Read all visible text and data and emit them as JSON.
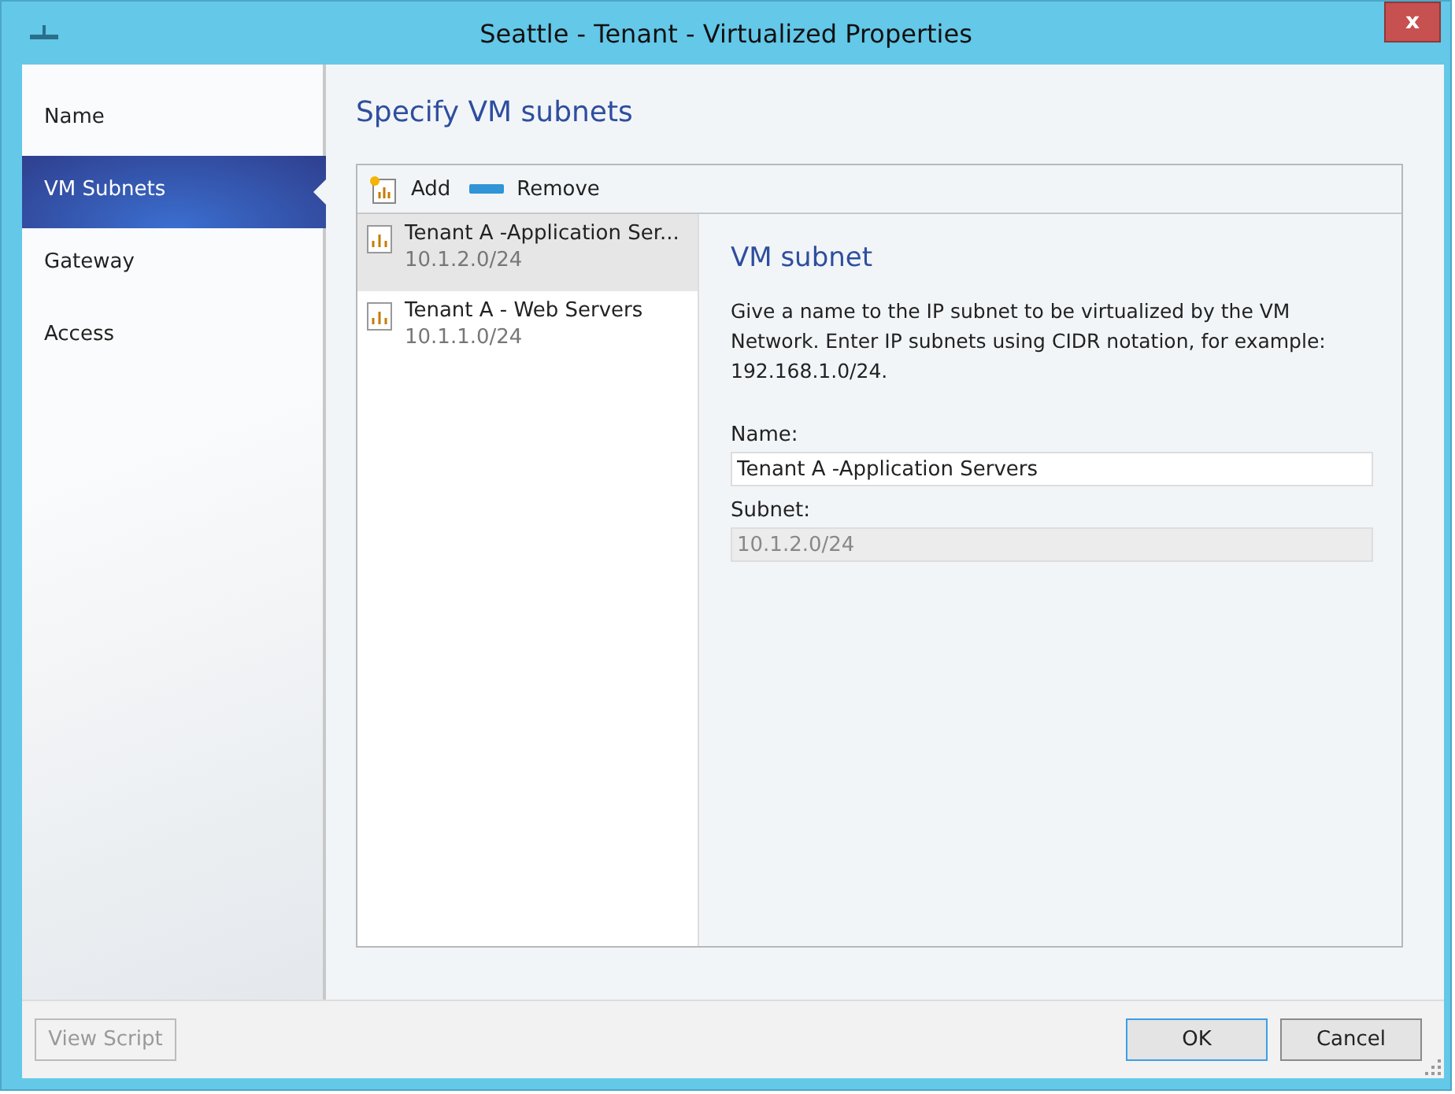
{
  "window": {
    "title": "Seattle - Tenant - Virtualized Properties",
    "close": "x"
  },
  "sidebar": {
    "items": [
      {
        "label": "Name",
        "selected": false
      },
      {
        "label": "VM Subnets",
        "selected": true
      },
      {
        "label": "Gateway",
        "selected": false
      },
      {
        "label": "Access",
        "selected": false
      }
    ]
  },
  "page_title": "Specify VM subnets",
  "toolbar": [
    {
      "kind": "add",
      "label": "Add"
    },
    {
      "kind": "remove",
      "label": "Remove"
    }
  ],
  "subnets": [
    {
      "name": "Tenant A -Application Ser...",
      "subnet": "10.1.2.0/24",
      "selected": true
    },
    {
      "name": "Tenant A - Web Servers",
      "subnet": "10.1.1.0/24",
      "selected": false
    }
  ],
  "details": {
    "heading": "VM subnet",
    "description": "Give a name to the IP subnet to be virtualized by the VM Network. Enter IP subnets using CIDR notation, for example: 192.168.1.0/24.",
    "fields": [
      {
        "label": "Name:",
        "value": "Tenant A -Application Servers",
        "disabled": false
      },
      {
        "label": "Subnet:",
        "value": "10.1.2.0/24",
        "disabled": true
      }
    ]
  },
  "footer": {
    "view_script": {
      "label": "View Script",
      "disabled": true
    },
    "ok": "OK",
    "cancel": "Cancel"
  }
}
